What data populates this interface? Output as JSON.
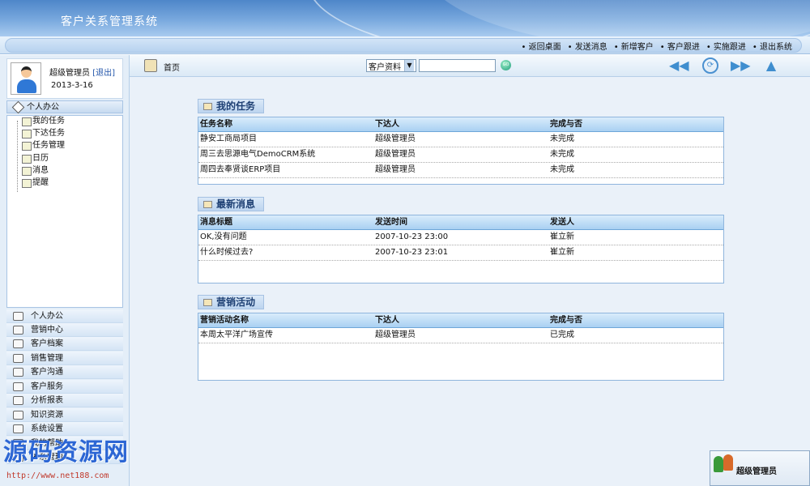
{
  "app": {
    "title": "客户关系管理系统"
  },
  "topnav": {
    "items": [
      "返回桌面",
      "发送消息",
      "新增客户",
      "客户跟进",
      "实施跟进",
      "退出系统"
    ]
  },
  "toolbar": {
    "home_label": "首页",
    "search_select": "客户资料",
    "search_value": "",
    "go_label": "GO"
  },
  "user": {
    "name": "超级管理员",
    "logout": "[退出]",
    "date": "2013-3-16"
  },
  "sidebar": {
    "panel_title": "个人办公",
    "tree": [
      "我的任务",
      "下达任务",
      "任务管理",
      "日历",
      "消息",
      "提醒"
    ],
    "nav": [
      "个人办公",
      "营销中心",
      "客户档案",
      "销售管理",
      "客户沟通",
      "客户服务",
      "分析报表",
      "知识资源",
      "系统设置",
      "我的帮助",
      "关系管理"
    ]
  },
  "sections": {
    "tasks": {
      "title": "我的任务",
      "headers": [
        "任务名称",
        "下达人",
        "完成与否"
      ],
      "rows": [
        [
          "静安工商局项目",
          "超级管理员",
          "未完成"
        ],
        [
          "周三去思源电气DemoCRM系统",
          "超级管理员",
          "未完成"
        ],
        [
          "周四去奉贤谈ERP项目",
          "超级管理员",
          "未完成"
        ]
      ]
    },
    "messages": {
      "title": "最新消息",
      "headers": [
        "消息标题",
        "发送时间",
        "发送人"
      ],
      "rows": [
        [
          "OK,没有问题",
          "2007-10-23 23:00",
          "崔立新"
        ],
        [
          "什么时候过去?",
          "2007-10-23 23:01",
          "崔立新"
        ]
      ]
    },
    "campaigns": {
      "title": "营销活动",
      "headers": [
        "营销活动名称",
        "下达人",
        "完成与否"
      ],
      "rows": [
        [
          "本周太平洋广场宣传",
          "超级管理员",
          "已完成"
        ]
      ]
    }
  },
  "watermark": {
    "text": "源码资源网",
    "url": "http://www.net188.com"
  },
  "userchip": {
    "name": "超级管理员"
  }
}
